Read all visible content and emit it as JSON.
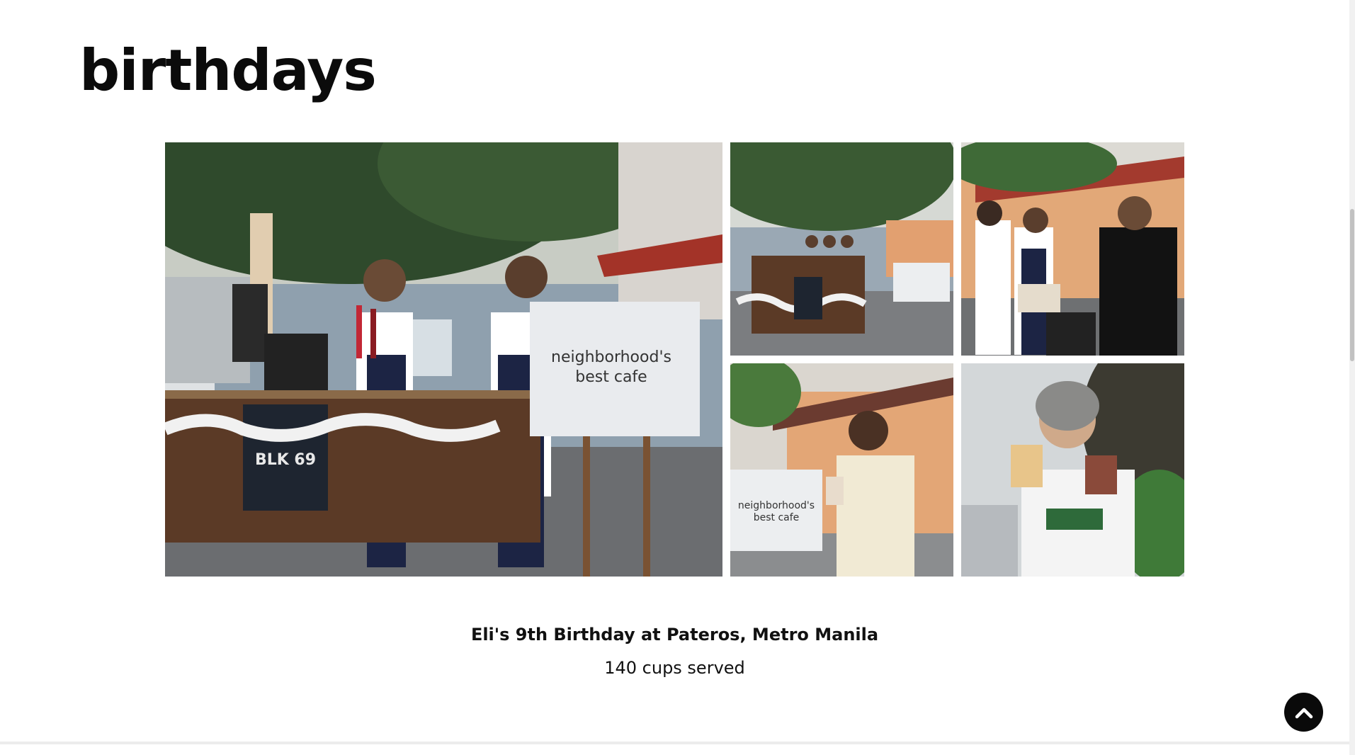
{
  "section": {
    "heading": "birthdays"
  },
  "gallery": {
    "photos": [
      {
        "name": "baristas-at-coffee-cart",
        "sign_line1": "neighborhood's",
        "sign_line2": "best cafe",
        "cart_logo": "BLK 69"
      },
      {
        "name": "coffee-cart-wide-shot"
      },
      {
        "name": "baristas-with-guest"
      },
      {
        "name": "birthday-boy-with-drink",
        "sign_line1": "neighborhood's",
        "sign_line2": "best cafe"
      },
      {
        "name": "guest-with-two-drinks"
      }
    ]
  },
  "event": {
    "title": "Eli's 9th Birthday at Pateros, Metro Manila",
    "details": "140 cups served"
  },
  "controls": {
    "scroll_top_icon": "chevron-up-icon"
  },
  "colors": {
    "text": "#111111",
    "button": "#0a0a0a",
    "sign": "#e9ebee",
    "cart_wood": "#5b3a26",
    "apron": "#1c2444"
  }
}
